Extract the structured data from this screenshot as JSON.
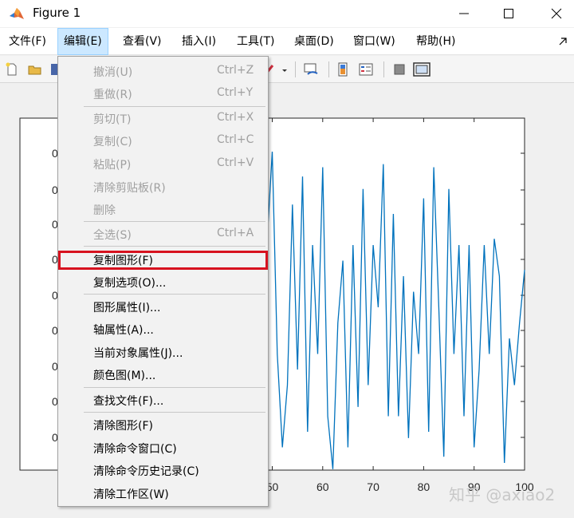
{
  "window": {
    "title": "Figure 1",
    "controls": {
      "minimize": "—",
      "maximize": "☐",
      "close": "✕"
    }
  },
  "menubar": {
    "items": [
      {
        "label": "文件(F)",
        "active": false
      },
      {
        "label": "编辑(E)",
        "active": true
      },
      {
        "label": "查看(V)",
        "active": false
      },
      {
        "label": "插入(I)",
        "active": false
      },
      {
        "label": "工具(T)",
        "active": false
      },
      {
        "label": "桌面(D)",
        "active": false
      },
      {
        "label": "窗口(W)",
        "active": false
      },
      {
        "label": "帮助(H)",
        "active": false
      }
    ]
  },
  "toolbar": {
    "icons": [
      "new-figure-icon",
      "open-icon",
      "save-icon",
      "brush-icon",
      "link-plot-icon",
      "insert-colorbar-icon",
      "insert-legend-icon",
      "hide-plot-tools-icon",
      "show-plot-tools-icon"
    ]
  },
  "edit_menu": {
    "items": [
      {
        "label": "撤消(U)",
        "shortcut": "Ctrl+Z",
        "enabled": false
      },
      {
        "label": "重做(R)",
        "shortcut": "Ctrl+Y",
        "enabled": false
      },
      {
        "label": "剪切(T)",
        "shortcut": "Ctrl+X",
        "enabled": false
      },
      {
        "label": "复制(C)",
        "shortcut": "Ctrl+C",
        "enabled": false
      },
      {
        "label": "粘贴(P)",
        "shortcut": "Ctrl+V",
        "enabled": false
      },
      {
        "label": "清除剪贴板(R)",
        "shortcut": "",
        "enabled": false
      },
      {
        "label": "删除",
        "shortcut": "",
        "enabled": false
      },
      {
        "label": "全选(S)",
        "shortcut": "Ctrl+A",
        "enabled": false
      },
      {
        "label": "复制图形(F)",
        "shortcut": "",
        "enabled": true,
        "highlighted": true
      },
      {
        "label": "复制选项(O)...",
        "shortcut": "",
        "enabled": true
      },
      {
        "label": "图形属性(I)...",
        "shortcut": "",
        "enabled": true
      },
      {
        "label": "轴属性(A)...",
        "shortcut": "",
        "enabled": true
      },
      {
        "label": "当前对象属性(J)...",
        "shortcut": "",
        "enabled": true
      },
      {
        "label": "颜色图(M)...",
        "shortcut": "",
        "enabled": true
      },
      {
        "label": "查找文件(F)...",
        "shortcut": "",
        "enabled": true
      },
      {
        "label": "清除图形(F)",
        "shortcut": "",
        "enabled": true
      },
      {
        "label": "清除命令窗口(C)",
        "shortcut": "",
        "enabled": true
      },
      {
        "label": "清除命令历史记录(C)",
        "shortcut": "",
        "enabled": true
      },
      {
        "label": "清除工作区(W)",
        "shortcut": "",
        "enabled": true
      }
    ],
    "highlight_color": "#d7121f"
  },
  "chart_data": {
    "type": "line",
    "xlim": [
      0,
      100
    ],
    "ylim": [
      0,
      1
    ],
    "x_tick_labels": [
      "50",
      "60",
      "70",
      "80",
      "90",
      "100"
    ],
    "x_ticks": [
      50,
      60,
      70,
      80,
      90,
      100
    ],
    "y_tick_labels": [
      "0",
      "0",
      "0",
      "0",
      "0",
      "0",
      "0",
      "0",
      "0"
    ],
    "line_color": "#0072bd",
    "series": [
      {
        "x": [
          44,
          45,
          46,
          47,
          48,
          49,
          50,
          51,
          52,
          53,
          54,
          55,
          56,
          57,
          58,
          59,
          60,
          61,
          62,
          63,
          64,
          65,
          66,
          67,
          68,
          69,
          70,
          71,
          72,
          73,
          74,
          75,
          76,
          77,
          78,
          79,
          80,
          81,
          82,
          83,
          84,
          85,
          86,
          87,
          88,
          89,
          90,
          91,
          92,
          93,
          94,
          95,
          96,
          97,
          98,
          99,
          100
        ],
        "y": [
          0.98,
          0.28,
          0.05,
          0.6,
          0.28,
          0.72,
          1.0,
          0.35,
          0.05,
          0.25,
          0.83,
          0.3,
          0.92,
          0.1,
          0.7,
          0.35,
          0.95,
          0.15,
          -0.02,
          0.45,
          0.65,
          0.05,
          0.7,
          0.18,
          0.88,
          0.25,
          0.7,
          0.5,
          0.96,
          0.15,
          0.8,
          0.15,
          0.6,
          0.08,
          0.55,
          0.35,
          0.85,
          0.1,
          0.95,
          0.5,
          0.02,
          0.88,
          0.35,
          0.7,
          0.15,
          0.7,
          0.05,
          0.3,
          0.7,
          0.35,
          0.72,
          0.6,
          0.0,
          0.4,
          0.25,
          0.45,
          0.62
        ]
      }
    ]
  },
  "watermark": "知乎 @axiao2"
}
